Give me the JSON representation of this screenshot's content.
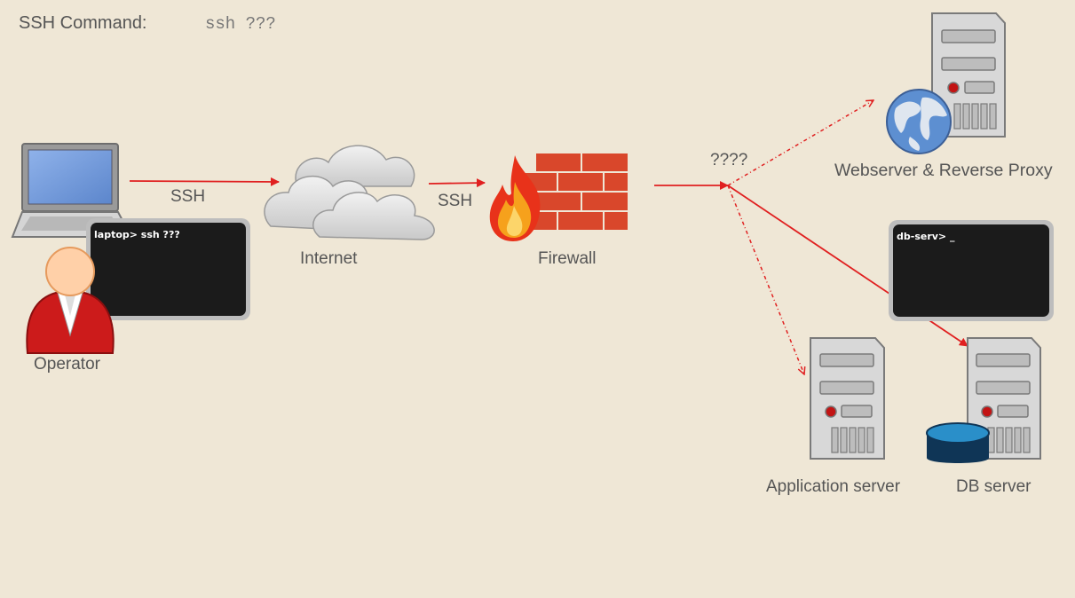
{
  "header": {
    "ssh_command_label": "SSH Command:",
    "ssh_command_value": "ssh ???"
  },
  "nodes": {
    "operator": "Operator",
    "internet": "Internet",
    "firewall": "Firewall",
    "webserver": "Webserver & Reverse Proxy",
    "app_server": "Application server",
    "db_server": "DB server"
  },
  "edges": {
    "laptop_to_internet": "SSH",
    "internet_to_firewall": "SSH",
    "unknown_route": "????"
  },
  "terminals": {
    "laptop": "laptop> ssh ???",
    "db": "db-serv> _"
  },
  "colors": {
    "background": "#efe7d6",
    "arrow": "#e02020",
    "terminal": "#1b1b1b",
    "brick": "#d9472b",
    "operator_suit": "#cc1b1b"
  }
}
